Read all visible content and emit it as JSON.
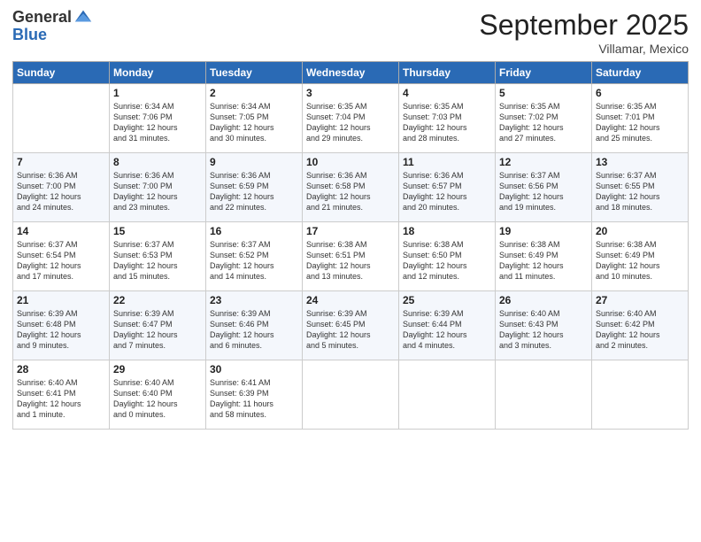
{
  "logo": {
    "general": "General",
    "blue": "Blue"
  },
  "title": {
    "month": "September 2025",
    "location": "Villamar, Mexico"
  },
  "days_of_week": [
    "Sunday",
    "Monday",
    "Tuesday",
    "Wednesday",
    "Thursday",
    "Friday",
    "Saturday"
  ],
  "weeks": [
    [
      {
        "day": "",
        "info": ""
      },
      {
        "day": "1",
        "info": "Sunrise: 6:34 AM\nSunset: 7:06 PM\nDaylight: 12 hours\nand 31 minutes."
      },
      {
        "day": "2",
        "info": "Sunrise: 6:34 AM\nSunset: 7:05 PM\nDaylight: 12 hours\nand 30 minutes."
      },
      {
        "day": "3",
        "info": "Sunrise: 6:35 AM\nSunset: 7:04 PM\nDaylight: 12 hours\nand 29 minutes."
      },
      {
        "day": "4",
        "info": "Sunrise: 6:35 AM\nSunset: 7:03 PM\nDaylight: 12 hours\nand 28 minutes."
      },
      {
        "day": "5",
        "info": "Sunrise: 6:35 AM\nSunset: 7:02 PM\nDaylight: 12 hours\nand 27 minutes."
      },
      {
        "day": "6",
        "info": "Sunrise: 6:35 AM\nSunset: 7:01 PM\nDaylight: 12 hours\nand 25 minutes."
      }
    ],
    [
      {
        "day": "7",
        "info": "Sunrise: 6:36 AM\nSunset: 7:00 PM\nDaylight: 12 hours\nand 24 minutes."
      },
      {
        "day": "8",
        "info": "Sunrise: 6:36 AM\nSunset: 7:00 PM\nDaylight: 12 hours\nand 23 minutes."
      },
      {
        "day": "9",
        "info": "Sunrise: 6:36 AM\nSunset: 6:59 PM\nDaylight: 12 hours\nand 22 minutes."
      },
      {
        "day": "10",
        "info": "Sunrise: 6:36 AM\nSunset: 6:58 PM\nDaylight: 12 hours\nand 21 minutes."
      },
      {
        "day": "11",
        "info": "Sunrise: 6:36 AM\nSunset: 6:57 PM\nDaylight: 12 hours\nand 20 minutes."
      },
      {
        "day": "12",
        "info": "Sunrise: 6:37 AM\nSunset: 6:56 PM\nDaylight: 12 hours\nand 19 minutes."
      },
      {
        "day": "13",
        "info": "Sunrise: 6:37 AM\nSunset: 6:55 PM\nDaylight: 12 hours\nand 18 minutes."
      }
    ],
    [
      {
        "day": "14",
        "info": "Sunrise: 6:37 AM\nSunset: 6:54 PM\nDaylight: 12 hours\nand 17 minutes."
      },
      {
        "day": "15",
        "info": "Sunrise: 6:37 AM\nSunset: 6:53 PM\nDaylight: 12 hours\nand 15 minutes."
      },
      {
        "day": "16",
        "info": "Sunrise: 6:37 AM\nSunset: 6:52 PM\nDaylight: 12 hours\nand 14 minutes."
      },
      {
        "day": "17",
        "info": "Sunrise: 6:38 AM\nSunset: 6:51 PM\nDaylight: 12 hours\nand 13 minutes."
      },
      {
        "day": "18",
        "info": "Sunrise: 6:38 AM\nSunset: 6:50 PM\nDaylight: 12 hours\nand 12 minutes."
      },
      {
        "day": "19",
        "info": "Sunrise: 6:38 AM\nSunset: 6:49 PM\nDaylight: 12 hours\nand 11 minutes."
      },
      {
        "day": "20",
        "info": "Sunrise: 6:38 AM\nSunset: 6:49 PM\nDaylight: 12 hours\nand 10 minutes."
      }
    ],
    [
      {
        "day": "21",
        "info": "Sunrise: 6:39 AM\nSunset: 6:48 PM\nDaylight: 12 hours\nand 9 minutes."
      },
      {
        "day": "22",
        "info": "Sunrise: 6:39 AM\nSunset: 6:47 PM\nDaylight: 12 hours\nand 7 minutes."
      },
      {
        "day": "23",
        "info": "Sunrise: 6:39 AM\nSunset: 6:46 PM\nDaylight: 12 hours\nand 6 minutes."
      },
      {
        "day": "24",
        "info": "Sunrise: 6:39 AM\nSunset: 6:45 PM\nDaylight: 12 hours\nand 5 minutes."
      },
      {
        "day": "25",
        "info": "Sunrise: 6:39 AM\nSunset: 6:44 PM\nDaylight: 12 hours\nand 4 minutes."
      },
      {
        "day": "26",
        "info": "Sunrise: 6:40 AM\nSunset: 6:43 PM\nDaylight: 12 hours\nand 3 minutes."
      },
      {
        "day": "27",
        "info": "Sunrise: 6:40 AM\nSunset: 6:42 PM\nDaylight: 12 hours\nand 2 minutes."
      }
    ],
    [
      {
        "day": "28",
        "info": "Sunrise: 6:40 AM\nSunset: 6:41 PM\nDaylight: 12 hours\nand 1 minute."
      },
      {
        "day": "29",
        "info": "Sunrise: 6:40 AM\nSunset: 6:40 PM\nDaylight: 12 hours\nand 0 minutes."
      },
      {
        "day": "30",
        "info": "Sunrise: 6:41 AM\nSunset: 6:39 PM\nDaylight: 11 hours\nand 58 minutes."
      },
      {
        "day": "",
        "info": ""
      },
      {
        "day": "",
        "info": ""
      },
      {
        "day": "",
        "info": ""
      },
      {
        "day": "",
        "info": ""
      }
    ]
  ]
}
